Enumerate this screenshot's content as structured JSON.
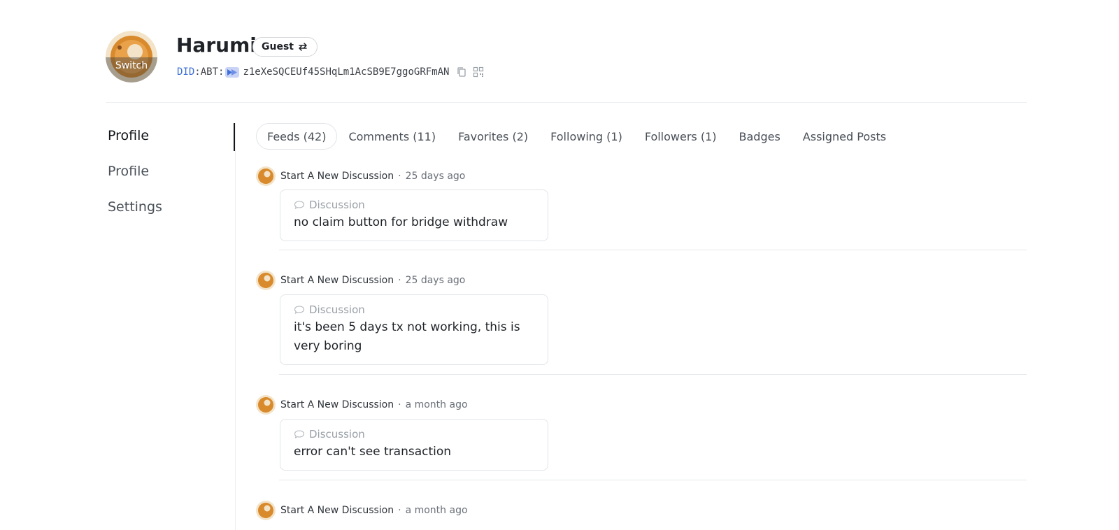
{
  "profile": {
    "name": "Harumi",
    "guest_label": "Guest",
    "switch_label": "Switch",
    "did_prefix": "DID",
    "did_sep": ":ABT:",
    "did_value": "z1eXeSQCEUf45SHqLm1AcSB9E7ggoGRFmAN",
    "copy_icon": "copy-icon",
    "qr_icon": "qrcode-icon",
    "swap_icon": "swap-arrows-icon"
  },
  "nav": {
    "items": [
      {
        "label": "Profile",
        "active": true
      },
      {
        "label": "Profile",
        "active": false
      },
      {
        "label": "Settings",
        "active": false
      }
    ]
  },
  "tabs": [
    {
      "label": "Feeds (42)",
      "active": true
    },
    {
      "label": "Comments (11)",
      "active": false
    },
    {
      "label": "Favorites (2)",
      "active": false
    },
    {
      "label": "Following (1)",
      "active": false
    },
    {
      "label": "Followers (1)",
      "active": false
    },
    {
      "label": "Badges",
      "active": false
    },
    {
      "label": "Assigned Posts",
      "active": false
    }
  ],
  "feed": [
    {
      "action": "Start A New Discussion",
      "time": "25 days ago",
      "type": "Discussion",
      "title": "no claim button for bridge withdraw"
    },
    {
      "action": "Start A New Discussion",
      "time": "25 days ago",
      "type": "Discussion",
      "title": "it's been 5 days tx not working, this is very boring"
    },
    {
      "action": "Start A New Discussion",
      "time": "a month ago",
      "type": "Discussion",
      "title": "error can't see transaction"
    },
    {
      "action": "Start A New Discussion",
      "time": "a month ago"
    }
  ],
  "separator": "·",
  "colors": {
    "accent_did": "#3d6fd8",
    "avatar_orange": "#d88a2c",
    "border": "#e3e5e8"
  }
}
